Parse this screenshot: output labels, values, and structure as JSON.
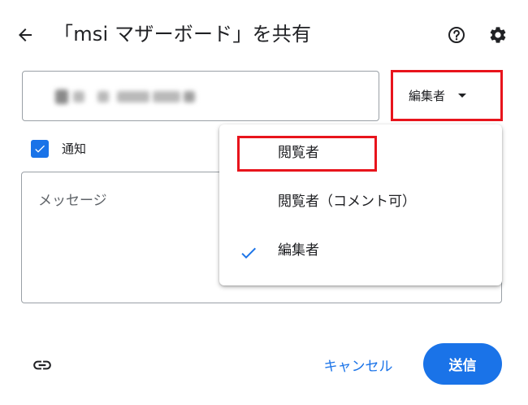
{
  "header": {
    "title": "「msi マザーボード」を共有",
    "back_icon": "arrow-back-icon",
    "help_icon": "help-circle-icon",
    "settings_icon": "gear-icon"
  },
  "recipient": {
    "value_blurred": true
  },
  "role_select": {
    "value": "編集者",
    "icon": "dropdown-caret-icon"
  },
  "notify": {
    "label": "通知",
    "checked": true
  },
  "message": {
    "placeholder": "メッセージ"
  },
  "role_menu": {
    "items": [
      {
        "label": "閲覧者",
        "selected": false,
        "highlighted": true
      },
      {
        "label": "閲覧者（コメント可）",
        "selected": false
      },
      {
        "label": "編集者",
        "selected": true
      }
    ]
  },
  "footer": {
    "link_icon": "link-icon",
    "cancel_label": "キャンセル",
    "send_label": "送信"
  },
  "colors": {
    "accent": "#1a73e8",
    "highlight": "#e8141c",
    "text": "#202124"
  }
}
